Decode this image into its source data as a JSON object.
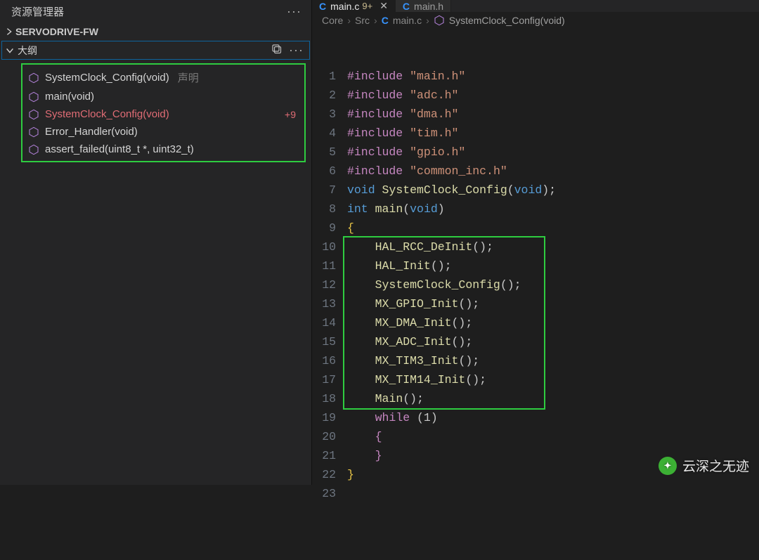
{
  "sidebar": {
    "title": "资源管理器",
    "workspace": "SERVODRIVE-FW",
    "outline_title": "大纲",
    "items": [
      {
        "label": "SystemClock_Config(void)",
        "suffix": "声明",
        "highlight": false
      },
      {
        "label": "main(void)",
        "suffix": "",
        "highlight": false
      },
      {
        "label": "SystemClock_Config(void)",
        "suffix": "",
        "highlight": true,
        "badge": "+9"
      },
      {
        "label": "Error_Handler(void)",
        "suffix": "",
        "highlight": false
      },
      {
        "label": "assert_failed(uint8_t *, uint32_t)",
        "suffix": "",
        "highlight": false
      }
    ]
  },
  "tabs": [
    {
      "icon": "C",
      "label": "main.c",
      "dirty": "9+",
      "active": true
    },
    {
      "icon": "C",
      "label": "main.h",
      "dirty": "",
      "active": false
    }
  ],
  "breadcrumbs": {
    "parts": [
      "Core",
      "Src"
    ],
    "file_icon": "C",
    "file": "main.c",
    "symbol": "SystemClock_Config(void)"
  },
  "code": {
    "lines": [
      {
        "n": 1,
        "kind": "inc",
        "inc": "#include",
        "str": "\"main.h\""
      },
      {
        "n": 2,
        "kind": "inc",
        "inc": "#include",
        "str": "\"adc.h\""
      },
      {
        "n": 3,
        "kind": "inc",
        "inc": "#include",
        "str": "\"dma.h\""
      },
      {
        "n": 4,
        "kind": "inc",
        "inc": "#include",
        "str": "\"tim.h\""
      },
      {
        "n": 5,
        "kind": "inc",
        "inc": "#include",
        "str": "\"gpio.h\""
      },
      {
        "n": 6,
        "kind": "inc",
        "inc": "#include",
        "str": "\"common_inc.h\""
      },
      {
        "n": 7,
        "kind": "decl",
        "t1": "void",
        "fn": "SystemClock_Config",
        "args": "void",
        "semi": ");"
      },
      {
        "n": 8,
        "kind": "decl",
        "t1": "int",
        "fn": "main",
        "args": "void",
        "semi": ")"
      },
      {
        "n": 9,
        "kind": "brace",
        "ch": "{",
        "cls": "brace-y"
      },
      {
        "n": 10,
        "kind": "call",
        "fn": "HAL_RCC_DeInit",
        "tail": "();",
        "indent": "    "
      },
      {
        "n": 11,
        "kind": "call",
        "fn": "HAL_Init",
        "tail": "();",
        "indent": "    "
      },
      {
        "n": 12,
        "kind": "call",
        "fn": "SystemClock_Config",
        "tail": "();",
        "indent": "    "
      },
      {
        "n": 13,
        "kind": "call",
        "fn": "MX_GPIO_Init",
        "tail": "();",
        "indent": "    "
      },
      {
        "n": 14,
        "kind": "call",
        "fn": "MX_DMA_Init",
        "tail": "();",
        "indent": "    "
      },
      {
        "n": 15,
        "kind": "call",
        "fn": "MX_ADC_Init",
        "tail": "();",
        "indent": "    "
      },
      {
        "n": 16,
        "kind": "call",
        "fn": "MX_TIM3_Init",
        "tail": "();",
        "indent": "    "
      },
      {
        "n": 17,
        "kind": "call",
        "fn": "MX_TIM14_Init",
        "tail": "();",
        "indent": "    "
      },
      {
        "n": 18,
        "kind": "call",
        "fn": "Main",
        "tail": "();",
        "indent": "    "
      },
      {
        "n": 19,
        "kind": "while",
        "pre": "    ",
        "kw": "while",
        "rest": " (1)"
      },
      {
        "n": 20,
        "kind": "brace",
        "ch": "    {",
        "cls": "brace-p"
      },
      {
        "n": 21,
        "kind": "brace",
        "ch": "    }",
        "cls": "brace-p"
      },
      {
        "n": 22,
        "kind": "brace",
        "ch": "}",
        "cls": "brace-y"
      },
      {
        "n": 23,
        "kind": "empty"
      }
    ]
  },
  "watermark": "云深之无迹"
}
